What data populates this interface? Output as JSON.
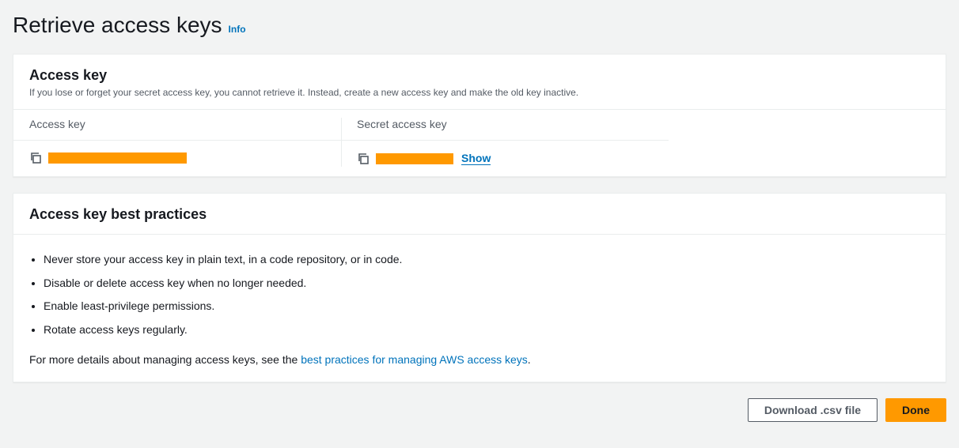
{
  "header": {
    "title": "Retrieve access keys",
    "info_label": "Info"
  },
  "access_key_panel": {
    "title": "Access key",
    "description": "If you lose or forget your secret access key, you cannot retrieve it. Instead, create a new access key and make the old key inactive.",
    "access_key_label": "Access key",
    "secret_key_label": "Secret access key",
    "show_label": "Show"
  },
  "best_practices": {
    "title": "Access key best practices",
    "items": [
      "Never store your access key in plain text, in a code repository, or in code.",
      "Disable or delete access key when no longer needed.",
      "Enable least-privilege permissions.",
      "Rotate access keys regularly."
    ],
    "footer_prefix": "For more details about managing access keys, see the ",
    "footer_link": "best practices for managing AWS access keys",
    "footer_suffix": "."
  },
  "actions": {
    "download_label": "Download .csv file",
    "done_label": "Done"
  }
}
